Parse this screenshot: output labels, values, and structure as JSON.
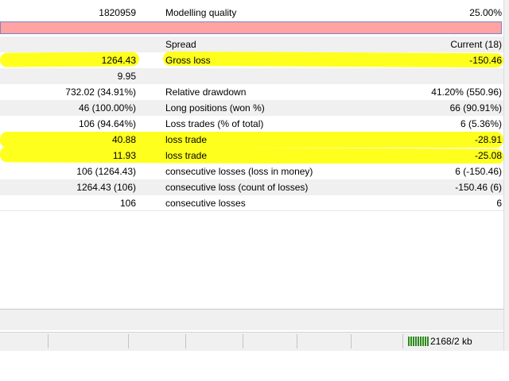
{
  "rows": [
    {
      "v1": "1820959",
      "l2": "Modelling quality",
      "v2": "25.00%"
    },
    {
      "v1": "",
      "l2": "",
      "v2": ""
    },
    {
      "v1": "",
      "l2": "Spread",
      "v2": "Current (18)"
    },
    {
      "v1": "1264.43",
      "l2": "Gross loss",
      "v2": "-150.46"
    },
    {
      "v1": "9.95",
      "l2": "",
      "v2": ""
    },
    {
      "v1": "732.02 (34.91%)",
      "l2": "Relative drawdown",
      "v2": "41.20% (550.96)"
    },
    {
      "v1": "46 (100.00%)",
      "l2": "Long positions (won %)",
      "v2": "66 (90.91%)"
    },
    {
      "v1": "106 (94.64%)",
      "l2": "Loss trades (% of total)",
      "v2": "6 (5.36%)"
    },
    {
      "v1": "40.88",
      "l2": "loss trade",
      "v2": "-28.91"
    },
    {
      "v1": "11.93",
      "l2": "loss trade",
      "v2": "-25.08"
    },
    {
      "v1": "106 (1264.43)",
      "l2": "consecutive losses (loss in money)",
      "v2": "6 (-150.46)"
    },
    {
      "v1": "1264.43 (106)",
      "l2": "consecutive loss (count of losses)",
      "v2": "-150.46 (6)"
    },
    {
      "v1": "106",
      "l2": "consecutive losses",
      "v2": "6"
    }
  ],
  "status": {
    "traffic_label": "2168/2 kb"
  },
  "colors": {
    "highlight": "#ffff1e",
    "error_bar": "#ffa3a3",
    "row_alt": "#f0f0f0",
    "traffic_bar": "#2e8b1e"
  }
}
